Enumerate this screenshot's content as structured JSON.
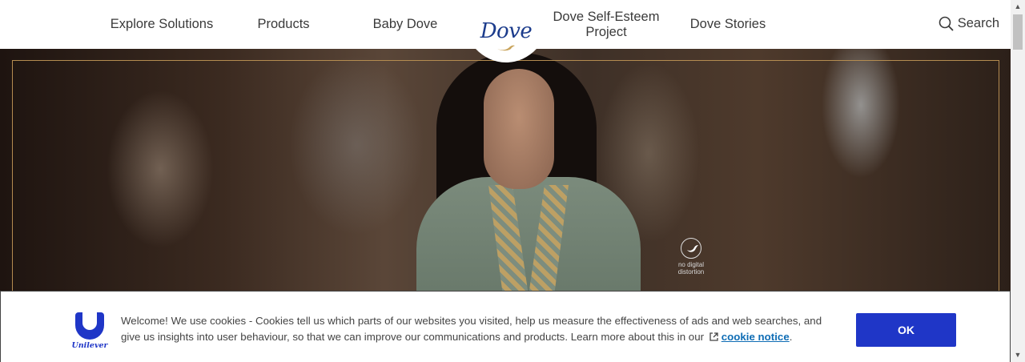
{
  "header": {
    "nav": {
      "explore_solutions": "Explore Solutions",
      "products": "Products",
      "baby_dove": "Baby Dove",
      "self_esteem_line1": "Dove Self-Esteem",
      "self_esteem_line2": "Project",
      "dove_stories": "Dove Stories"
    },
    "logo_text": "Dove",
    "search_label": "Search"
  },
  "hero": {
    "badge_line1": "no digital",
    "badge_line2": "distortion"
  },
  "cookie_banner": {
    "logo_text": "Unilever",
    "message": "Welcome! We use cookies - Cookies tell us which parts of our websites you visited, help us measure the effectiveness of ads and web searches, and give us insights into user behaviour, so that we can improve our communications and products. Learn more about this in our",
    "link_text": "cookie notice",
    "suffix": ".",
    "ok_label": "OK"
  },
  "colors": {
    "brand_blue": "#1c3c8c",
    "unilever_blue": "#1f36c7",
    "link_blue": "#0f6db5",
    "frame_gold": "#b48c50"
  },
  "icons": [
    "search-icon",
    "dove-bird-icon",
    "external-link-icon",
    "no-digital-distortion-icon",
    "scroll-up-icon",
    "scroll-down-icon"
  ]
}
